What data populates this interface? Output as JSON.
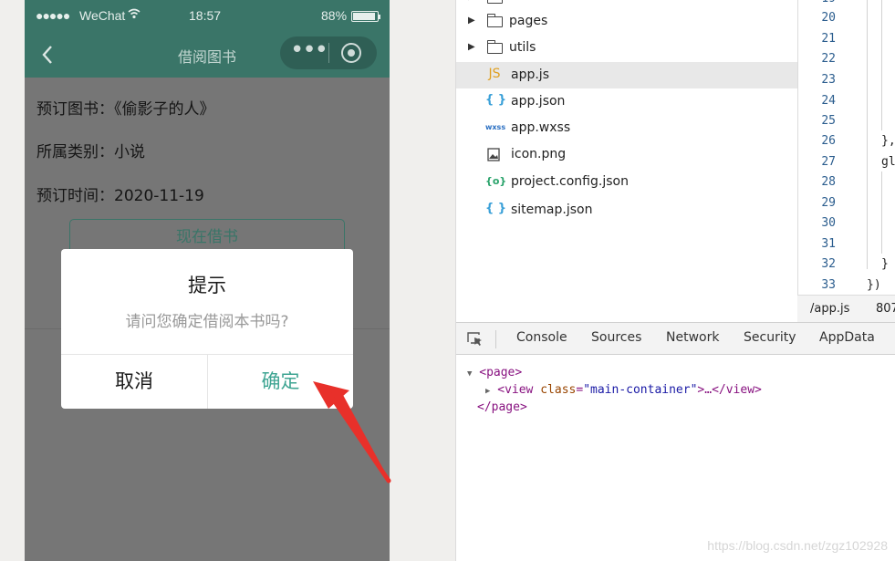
{
  "simulator": {
    "status_bar": {
      "signal": "●●●●●",
      "carrier": "WeChat",
      "time": "18:57",
      "battery": "88%"
    },
    "nav": {
      "back": "<",
      "title": "借阅图书",
      "more": "•••"
    },
    "content": {
      "book": "预订图书：《偷影子的人》",
      "category": "所属类别：小说",
      "time": "预订时间：2020-11-19",
      "borrow_button": "现在借书"
    },
    "modal": {
      "title": "提示",
      "message": "请问您确定借阅本书吗?",
      "cancel": "取消",
      "confirm": "确定"
    }
  },
  "file_tree": {
    "items": [
      {
        "type": "folder",
        "label": "pages"
      },
      {
        "type": "folder",
        "label": "utils"
      },
      {
        "type": "js",
        "icon": "JS",
        "label": "app.js",
        "selected": true
      },
      {
        "type": "json",
        "icon": "{ }",
        "label": "app.json"
      },
      {
        "type": "wxss",
        "icon": "wxss",
        "label": "app.wxss"
      },
      {
        "type": "image",
        "icon": "image-icon",
        "label": "icon.png"
      },
      {
        "type": "config",
        "icon": "{o}",
        "label": "project.config.json"
      },
      {
        "type": "json",
        "icon": "{ }",
        "label": "sitemap.json"
      }
    ]
  },
  "code": {
    "line_numbers": [
      "20",
      "21",
      "22",
      "23",
      "24",
      "25",
      "26",
      "27",
      "28",
      "29",
      "30",
      "31",
      "32",
      "33"
    ],
    "lines": [
      "",
      "",
      "",
      "",
      "",
      "",
      "},",
      "gl",
      "",
      "",
      "",
      "",
      "}",
      "})"
    ],
    "status_file": "/app.js",
    "status_pos": "807"
  },
  "devtools": {
    "tabs": [
      "Console",
      "Sources",
      "Network",
      "Security",
      "AppData"
    ],
    "dom": {
      "open_page": "<page>",
      "view_open": "<view",
      "attr_name": "class",
      "attr_value": "\"main-container\"",
      "view_rest": ">…</view>",
      "close_page": "</page>"
    }
  },
  "watermark": "https://blog.csdn.net/zgz102928",
  "colors": {
    "nav_green": "#3a7568",
    "confirm_green": "#3fa593",
    "arrow_red": "#e8302a",
    "line_number_blue": "#2b5d8e"
  }
}
